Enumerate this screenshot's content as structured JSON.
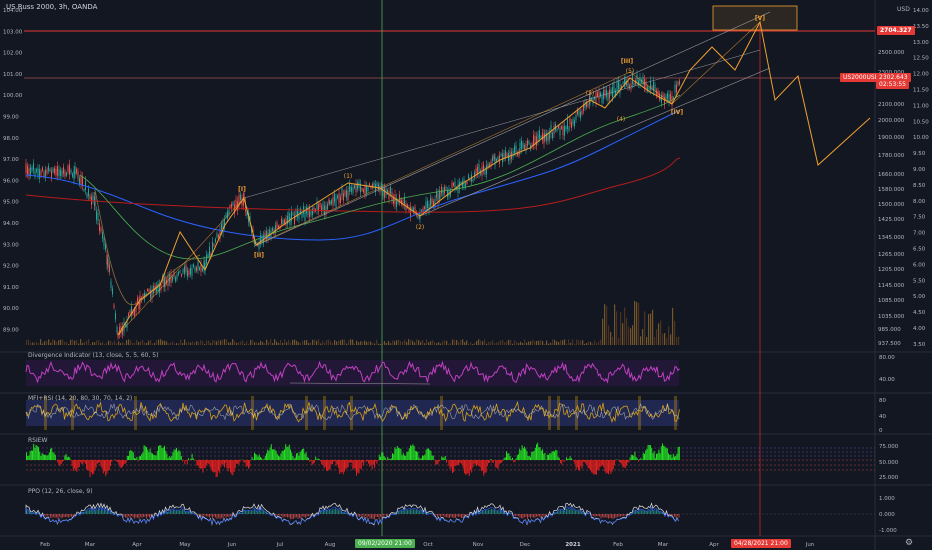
{
  "header": {
    "title": "US Russ 2000, 3h, OANDA",
    "currency": "USD"
  },
  "left_axis": [
    "104.00",
    "103.00",
    "102.00",
    "101.00",
    "100.00",
    "99.00",
    "98.00",
    "97.00",
    "96.00",
    "95.00",
    "94.00",
    "93.00",
    "92.00",
    "91.00",
    "90.00",
    "89.00"
  ],
  "right_axis_price": [
    "2500.000",
    "2300.000",
    "2100.000",
    "2000.000",
    "1900.000",
    "1780.000",
    "1660.000",
    "1580.000",
    "1500.000",
    "1425.000",
    "1345.000",
    "1265.000",
    "1205.000",
    "1145.000",
    "1085.000",
    "1035.000",
    "985.000",
    "937.500"
  ],
  "right_axis_outer": [
    "14.00",
    "13.50",
    "13.00",
    "12.50",
    "12.00",
    "11.50",
    "11.00",
    "10.50",
    "10.00",
    "9.50",
    "9.00",
    "8.50",
    "8.00",
    "7.50",
    "7.00",
    "6.50",
    "6.00",
    "5.50",
    "5.00",
    "4.50",
    "4.00",
    "3.50"
  ],
  "price_badges": {
    "level_top": "2704.327",
    "symbol": "US2000USD",
    "last": "2302.643",
    "countdown": "02:53:55"
  },
  "wave_labels": {
    "w1": "[I]",
    "w2": "[II]",
    "w3": "[III]",
    "w4": "[IV]",
    "w5": "[V]",
    "s1": "(1)",
    "s2": "(2)",
    "s3": "(3)",
    "s4": "(4)",
    "s5": "(5)"
  },
  "panes": {
    "divergence": {
      "label": "Divergence Indicator (13, close, 5, 5, 60, 5)",
      "ticks": [
        "80.00",
        "40.00"
      ]
    },
    "mfi": {
      "label": "MFI+RSI (14, 20, 80, 30, 70, 14, 2)",
      "ticks": [
        "80",
        "40",
        "0"
      ]
    },
    "rsiew": {
      "label": "RSIEW",
      "ticks": [
        "75.000",
        "50.000",
        "25.000"
      ]
    },
    "ppo": {
      "label": "PPO (12, 26, close, 9)",
      "ticks": [
        "1.000",
        "0.000",
        "-1.000"
      ]
    }
  },
  "time_axis": [
    "Feb",
    "Mar",
    "Apr",
    "May",
    "Jun",
    "Jul",
    "Aug",
    "Oct",
    "Nov",
    "Dec",
    "2021",
    "Feb",
    "Mar",
    "Apr",
    "Jun"
  ],
  "time_badges": {
    "vertical_line_date": "09/02/2020",
    "vertical_line_time": "21:00",
    "target_date": "04/28/2021",
    "target_time": "21:00"
  },
  "colors": {
    "background": "#131722",
    "price_up": "#26a69a",
    "price_down": "#ef5350",
    "wave_orange": "#f0a030",
    "level_red": "#e53935",
    "divergence_magenta": "#c040c0",
    "rsi_green": "#22dd22",
    "rsi_red": "#e02020"
  }
}
